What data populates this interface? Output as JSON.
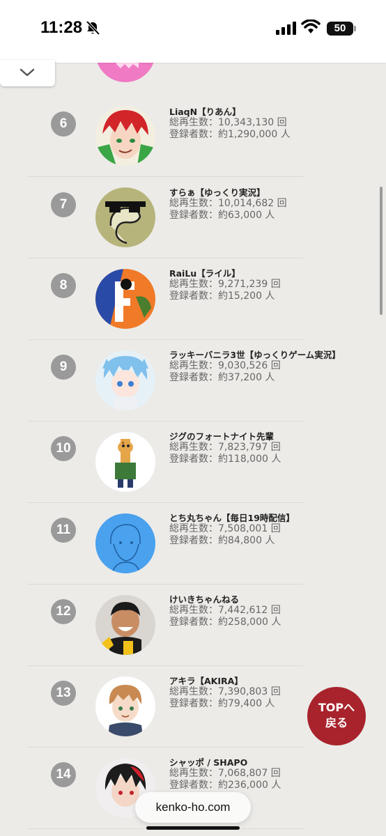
{
  "status": {
    "time": "11:28",
    "battery": "50"
  },
  "url": "kenko-ho.com",
  "top_button": {
    "line1": "TOPへ",
    "line2": "戻る"
  },
  "rows": [
    {
      "rank": "6",
      "name": "LiaqN【りあん】",
      "views": "総再生数：10,343,130 回",
      "subs": "登録者数：約1,290,000 人",
      "avatar": "red-haired-anime-avatar"
    },
    {
      "rank": "7",
      "name": "すらぁ【ゆっくり実況】",
      "views": "総再生数：10,014,682 回",
      "subs": "登録者数：約63,000 人",
      "avatar": "sunglasses-snake-avatar"
    },
    {
      "rank": "8",
      "name": "RaiLu【ライル】",
      "views": "総再生数：9,271,239 回",
      "subs": "登録者数：約15,200 人",
      "avatar": "fortnite-f-avatar"
    },
    {
      "rank": "9",
      "name": "ラッキーバニラ3世【ゆっくりゲーム実況】",
      "views": "総再生数：9,030,526 回",
      "subs": "登録者数：約37,200 人",
      "avatar": "blue-haired-anime-avatar"
    },
    {
      "rank": "10",
      "name": "ジグのフォートナイト先輩",
      "views": "総再生数：7,823,797 回",
      "subs": "登録者数：約118,000 人",
      "avatar": "giraffe-avatar"
    },
    {
      "rank": "11",
      "name": "とち丸ちゃん【毎日19時配信】",
      "views": "総再生数：7,508,001 回",
      "subs": "登録者数：約84,800 人",
      "avatar": "sketch-blue-avatar"
    },
    {
      "rank": "12",
      "name": "けいきちゃんねる",
      "views": "総再生数：7,442,612 回",
      "subs": "登録者数：約258,000 人",
      "avatar": "laughing-boy-photo-avatar"
    },
    {
      "rank": "13",
      "name": "アキラ【AKIRA】",
      "views": "総再生数：7,390,803 回",
      "subs": "登録者数：約79,400 人",
      "avatar": "brown-haired-boy-avatar"
    },
    {
      "rank": "14",
      "name": "シャッポ / SHAPO",
      "views": "総再生数：7,068,807 回",
      "subs": "登録者数：約236,000 人",
      "avatar": "black-red-haired-anime-avatar"
    }
  ]
}
